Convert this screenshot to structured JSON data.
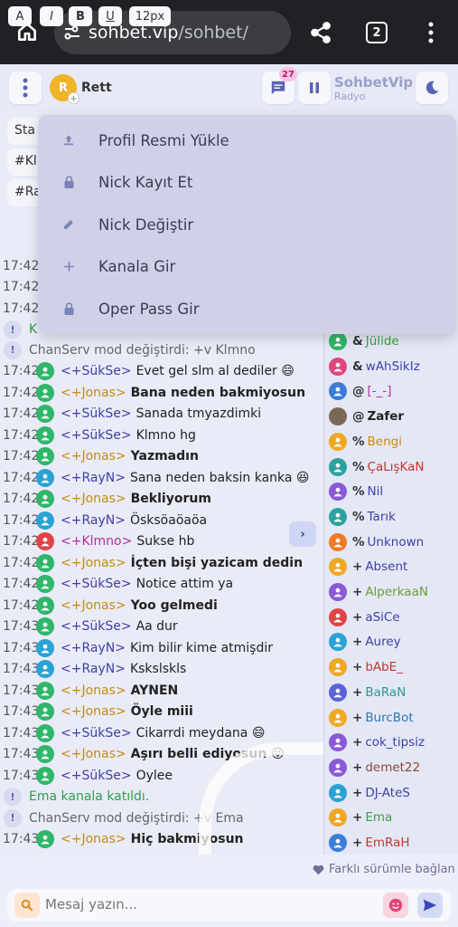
{
  "browser": {
    "url_host": "sohbet.vip",
    "url_path": "/sohbet/",
    "tab_count": "2"
  },
  "topbar": {
    "user_initial": "R",
    "user_nick": "Rett",
    "message_count": "27",
    "radio_name": "SohbetVip",
    "radio_sub": "Radyo"
  },
  "chips": [
    "Sta",
    "#Kl",
    "#Ra"
  ],
  "menu": {
    "items": [
      {
        "label": "Profil Resmi Yükle",
        "icon": "upload-icon"
      },
      {
        "label": "Nick Kayıt Et",
        "icon": "lock-icon"
      },
      {
        "label": "Nick Değiştir",
        "icon": "pencil-icon"
      },
      {
        "label": "Kanala Gir",
        "icon": "plus-icon"
      },
      {
        "label": "Oper Pass Gir",
        "icon": "lock-icon"
      }
    ]
  },
  "chat": {
    "hidden_times": [
      "17:42",
      "17:42",
      "17:42"
    ],
    "hidden_sys": "K",
    "messages": [
      {
        "type": "sys",
        "text": "ChanServ mod değiştirdi: +v Klmno"
      },
      {
        "type": "msg",
        "time": "17:42",
        "nick": "<+SükSe>",
        "text": "Evet gel slm al dediler 😄",
        "color": "#3f3fa8",
        "av": "#2fb66a",
        "bold": false
      },
      {
        "type": "msg",
        "time": "17:42",
        "nick": "<+Jonas>",
        "text": "Bana neden bakmiyosun",
        "color": "#c98a12",
        "av": "#2fb66a",
        "bold": true
      },
      {
        "type": "msg",
        "time": "17:42",
        "nick": "<+SükSe>",
        "text": "Sanada tmyazdimki",
        "color": "#3f3fa8",
        "av": "#2fb66a",
        "bold": false
      },
      {
        "type": "msg",
        "time": "17:42",
        "nick": "<+SükSe>",
        "text": "Klmno hg",
        "color": "#3f3fa8",
        "av": "#2fb66a",
        "bold": false
      },
      {
        "type": "msg",
        "time": "17:42",
        "nick": "<+Jonas>",
        "text": "Yazmadın",
        "color": "#c98a12",
        "av": "#2fb66a",
        "bold": true
      },
      {
        "type": "msg",
        "time": "17:42",
        "nick": "<+RayN>",
        "text": "Sana neden baksin kanka 😆",
        "color": "#3f3fa8",
        "av": "#2ba2d6",
        "bold": false
      },
      {
        "type": "msg",
        "time": "17:42",
        "nick": "<+Jonas>",
        "text": "Bekliyorum",
        "color": "#c98a12",
        "av": "#2fb66a",
        "bold": true
      },
      {
        "type": "msg",
        "time": "17:42",
        "nick": "<+RayN>",
        "text": "Ösksöaöaöa",
        "color": "#3f3fa8",
        "av": "#2ba2d6",
        "bold": false
      },
      {
        "type": "msg",
        "time": "17:42",
        "nick": "<+Klmno>",
        "text": "Sukse hb",
        "color": "#b4309c",
        "av": "#e04545",
        "bold": false
      },
      {
        "type": "msg",
        "time": "17:42",
        "nick": "<+Jonas>",
        "text": "İçten bişi yazicam dedin",
        "color": "#c98a12",
        "av": "#2fb66a",
        "bold": true
      },
      {
        "type": "msg",
        "time": "17:42",
        "nick": "<+SükSe>",
        "text": "Notice attim ya",
        "color": "#3f3fa8",
        "av": "#2fb66a",
        "bold": false
      },
      {
        "type": "msg",
        "time": "17:42",
        "nick": "<+Jonas>",
        "text": "Yoo gelmedi",
        "color": "#c98a12",
        "av": "#2fb66a",
        "bold": true
      },
      {
        "type": "msg",
        "time": "17:43",
        "nick": "<+SükSe>",
        "text": "Aa dur",
        "color": "#3f3fa8",
        "av": "#2fb66a",
        "bold": false
      },
      {
        "type": "msg",
        "time": "17:43",
        "nick": "<+RayN>",
        "text": "Kim bilir kime atmişdir",
        "color": "#3f3fa8",
        "av": "#2ba2d6",
        "bold": false
      },
      {
        "type": "msg",
        "time": "17:43",
        "nick": "<+RayN>",
        "text": "Kskslskls",
        "color": "#3f3fa8",
        "av": "#2ba2d6",
        "bold": false
      },
      {
        "type": "msg",
        "time": "17:43",
        "nick": "<+Jonas>",
        "text": "AYNEN",
        "color": "#c98a12",
        "av": "#2fb66a",
        "bold": true
      },
      {
        "type": "msg",
        "time": "17:43",
        "nick": "<+Jonas>",
        "text": "Öyle miii",
        "color": "#c98a12",
        "av": "#2fb66a",
        "bold": true
      },
      {
        "type": "msg",
        "time": "17:43",
        "nick": "<+SükSe>",
        "text": "Cikarrdi meydana 😄",
        "color": "#3f3fa8",
        "av": "#2fb66a",
        "bold": false
      },
      {
        "type": "msg",
        "time": "17:43",
        "nick": "<+Jonas>",
        "text": "Aşırı belli ediyosun 😛",
        "color": "#c98a12",
        "av": "#2fb66a",
        "bold": true
      },
      {
        "type": "msg",
        "time": "17:43",
        "nick": "<+SükSe>",
        "text": "Oylee",
        "color": "#3f3fa8",
        "av": "#2fb66a",
        "bold": false
      },
      {
        "type": "sys",
        "text": "Ema kanala katıldı.",
        "green": true
      },
      {
        "type": "sys",
        "text": "ChanServ mod değiştirdi: +v Ema"
      },
      {
        "type": "msg",
        "time": "17:43",
        "nick": "<+Jonas>",
        "text": "Hiç bakmiyosun",
        "color": "#c98a12",
        "av": "#2fb66a",
        "bold": true
      }
    ]
  },
  "users": [
    {
      "mode": "&",
      "name": "Jülide",
      "color": "#3aa040",
      "av": "#2fb66a"
    },
    {
      "mode": "&",
      "name": "wAhSikIz",
      "color": "#3f3fa8",
      "av": "#e0457b"
    },
    {
      "mode": "@",
      "name": "[-_-]",
      "color": "#b4309c",
      "av": "#3b7dd8"
    },
    {
      "mode": "@",
      "name": "Zafer",
      "color": "#222",
      "av": "#7a6a55",
      "bold": true
    },
    {
      "mode": "%",
      "name": "Bengi",
      "color": "#c98a12",
      "av": "#f0a824"
    },
    {
      "mode": "%",
      "name": "ÇaLışKaN",
      "color": "#c0392b",
      "av": "#2ba2a0"
    },
    {
      "mode": "%",
      "name": "Nil",
      "color": "#3f3fa8",
      "av": "#8a5ad6"
    },
    {
      "mode": "%",
      "name": "Tarık",
      "color": "#3f3fa8",
      "av": "#2ba2a0"
    },
    {
      "mode": "%",
      "name": "Unknown",
      "color": "#3f3fa8",
      "av": "#f07a24"
    },
    {
      "mode": "+",
      "name": "Absent",
      "color": "#3f3fa8",
      "av": "#f0a824"
    },
    {
      "mode": "+",
      "name": "AlperkaaN",
      "color": "#6aa030",
      "av": "#8a5ad6"
    },
    {
      "mode": "+",
      "name": "aSiCe",
      "color": "#3f3fa8",
      "av": "#e04545"
    },
    {
      "mode": "+",
      "name": "Aurey",
      "color": "#3f3fa8",
      "av": "#2ba2d6"
    },
    {
      "mode": "+",
      "name": "bAbE_",
      "color": "#c0392b",
      "av": "#f0a824"
    },
    {
      "mode": "+",
      "name": "BaRaN",
      "color": "#2a9a8a",
      "av": "#5a64d6"
    },
    {
      "mode": "+",
      "name": "BurcBot",
      "color": "#2a7ab8",
      "av": "#f0a824"
    },
    {
      "mode": "+",
      "name": "cok_tipsiz",
      "color": "#3f3fa8",
      "av": "#8a5ad6"
    },
    {
      "mode": "+",
      "name": "demet22",
      "color": "#8a4a30",
      "av": "#8a5ad6"
    },
    {
      "mode": "+",
      "name": "DJ-AteS",
      "color": "#3f3fa8",
      "av": "#2ba2d6"
    },
    {
      "mode": "+",
      "name": "Ema",
      "color": "#3aa040",
      "av": "#f0a824"
    },
    {
      "mode": "+",
      "name": "EmRaH",
      "color": "#c0392b",
      "av": "#3b7dd8"
    }
  ],
  "toolbar": {
    "a_label": "A",
    "i_label": "I",
    "b_label": "B",
    "u_label": "U",
    "size_label": "12px",
    "farkli": "Farklı sürümle bağlan"
  },
  "input": {
    "placeholder": "Mesaj yazın..."
  },
  "colors": {
    "accent": "#5a64b0",
    "browser_bg": "#202124",
    "menu_bg": "#cfd2e6"
  }
}
